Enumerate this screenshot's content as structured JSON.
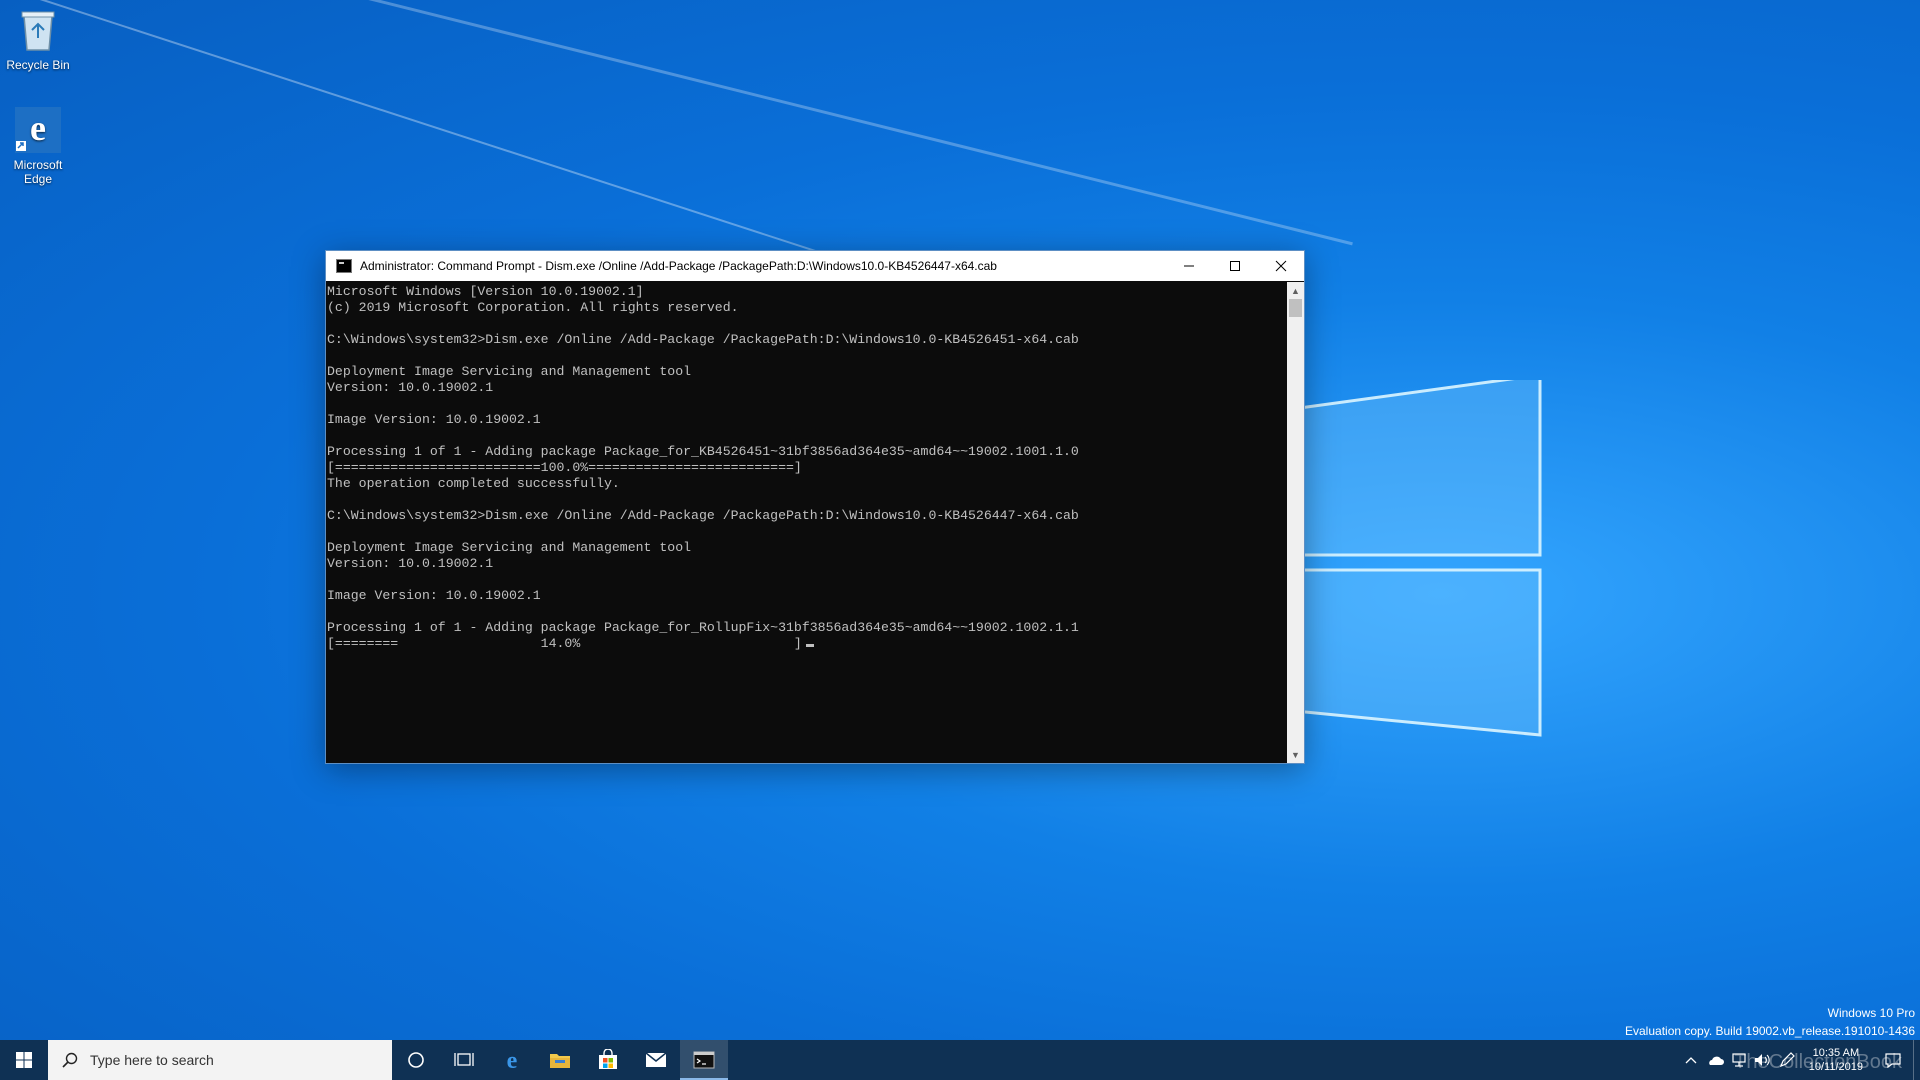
{
  "desktop": {
    "icons": [
      {
        "label": "Recycle Bin",
        "icon": "recycle-bin-icon"
      },
      {
        "label": "Microsoft Edge",
        "icon": "edge-icon"
      }
    ],
    "watermark": {
      "edition": "Windows 10 Pro",
      "build": "Evaluation copy. Build 19002.vb_release.191010-1436"
    },
    "brand": "TheCollectionBook"
  },
  "window": {
    "title": "Administrator: Command Prompt - Dism.exe  /Online /Add-Package /PackagePath:D:\\Windows10.0-KB4526447-x64.cab",
    "console_lines": [
      "Microsoft Windows [Version 10.0.19002.1]",
      "(c) 2019 Microsoft Corporation. All rights reserved.",
      "",
      "C:\\Windows\\system32>Dism.exe /Online /Add-Package /PackagePath:D:\\Windows10.0-KB4526451-x64.cab",
      "",
      "Deployment Image Servicing and Management tool",
      "Version: 10.0.19002.1",
      "",
      "Image Version: 10.0.19002.1",
      "",
      "Processing 1 of 1 - Adding package Package_for_KB4526451~31bf3856ad364e35~amd64~~19002.1001.1.0",
      "[==========================100.0%==========================]",
      "The operation completed successfully.",
      "",
      "C:\\Windows\\system32>Dism.exe /Online /Add-Package /PackagePath:D:\\Windows10.0-KB4526447-x64.cab",
      "",
      "Deployment Image Servicing and Management tool",
      "Version: 10.0.19002.1",
      "",
      "Image Version: 10.0.19002.1",
      "",
      "Processing 1 of 1 - Adding package Package_for_RollupFix~31bf3856ad364e35~amd64~~19002.1002.1.1",
      "[========                  14.0%                           ]"
    ]
  },
  "taskbar": {
    "search_placeholder": "Type here to search",
    "pinned": [
      "cortana-icon",
      "task-view-icon",
      "edge-icon",
      "file-explorer-icon",
      "store-icon",
      "mail-icon",
      "cmd-icon"
    ],
    "time": "10:35 AM",
    "date": "10/11/2019"
  },
  "colors": {
    "console_bg": "#0c0c0c",
    "console_text": "#c0c0c0",
    "taskbar_bg": "#0f3154"
  }
}
